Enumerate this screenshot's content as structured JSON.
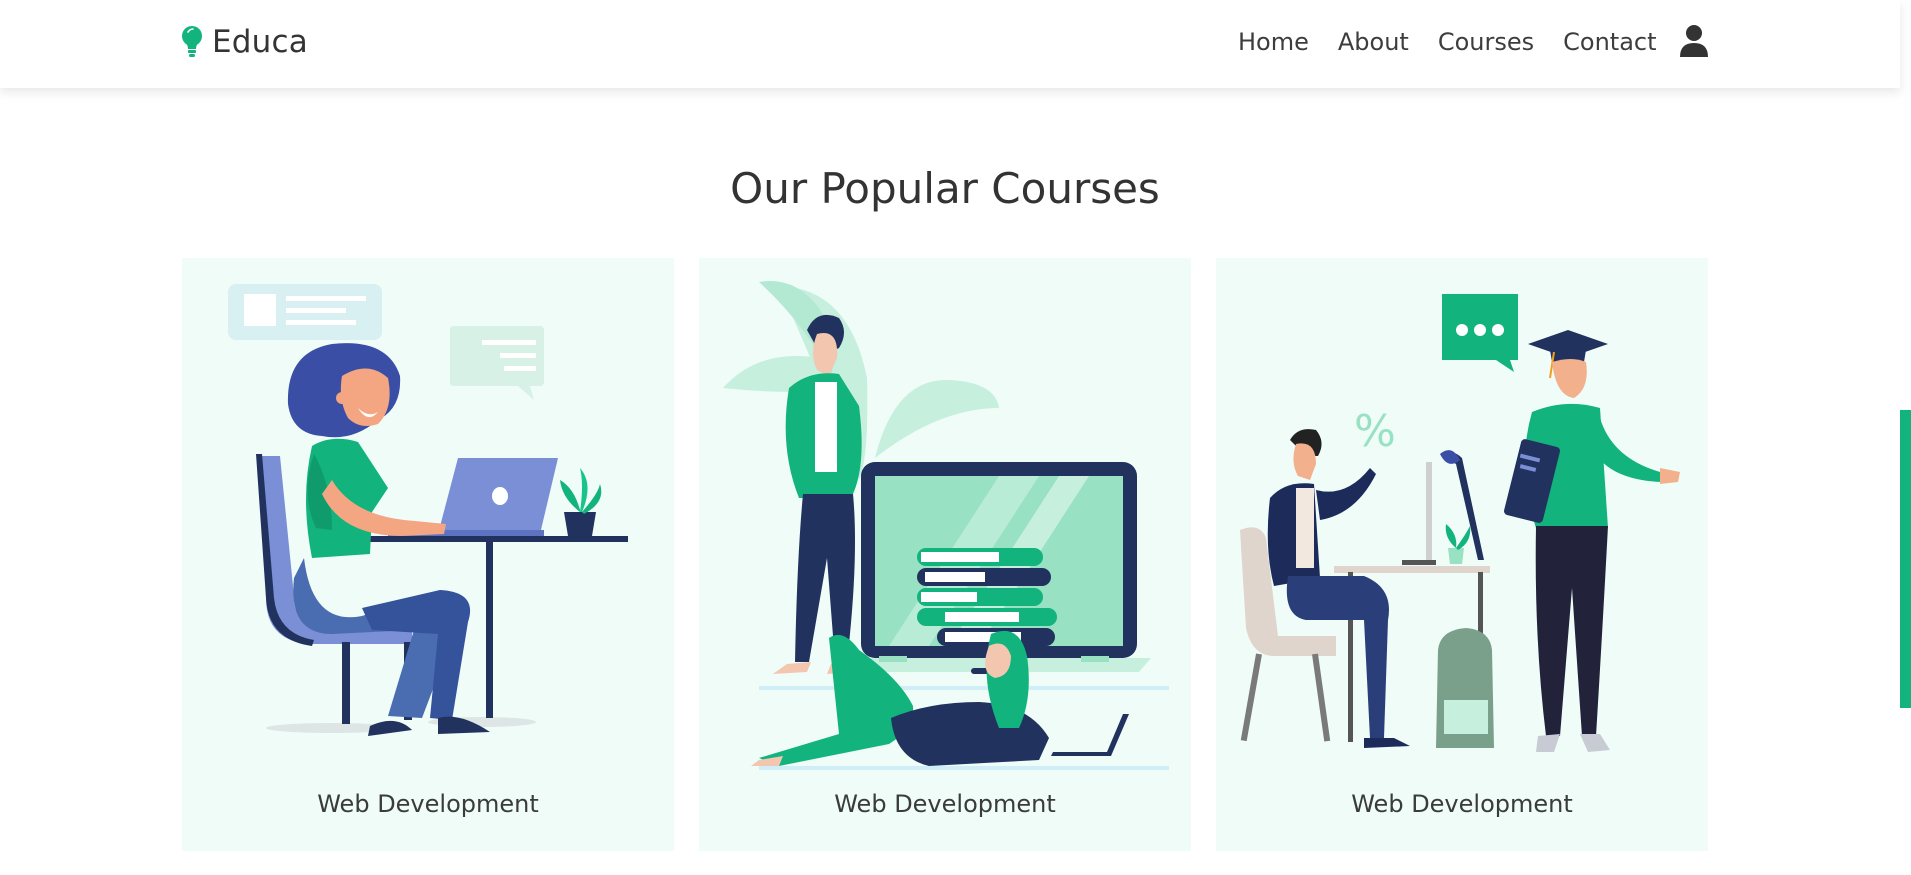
{
  "brand": {
    "name": "Educa",
    "icon": "lightbulb-icon",
    "icon_color": "#12b37c"
  },
  "nav": {
    "links": [
      {
        "label": "Home"
      },
      {
        "label": "About"
      },
      {
        "label": "Courses"
      },
      {
        "label": "Contact"
      }
    ],
    "user_icon": "user-icon"
  },
  "section": {
    "title": "Our Popular Courses"
  },
  "courses": [
    {
      "title": "Web Development",
      "illustration": "woman-working-on-laptop"
    },
    {
      "title": "Web Development",
      "illustration": "students-with-large-laptop-and-books"
    },
    {
      "title": "Web Development",
      "illustration": "student-at-desk-and-graduate"
    }
  ],
  "colors": {
    "accent": "#12b37c",
    "card_background": "#effcf8",
    "text": "#333333",
    "navy": "#22325e"
  }
}
